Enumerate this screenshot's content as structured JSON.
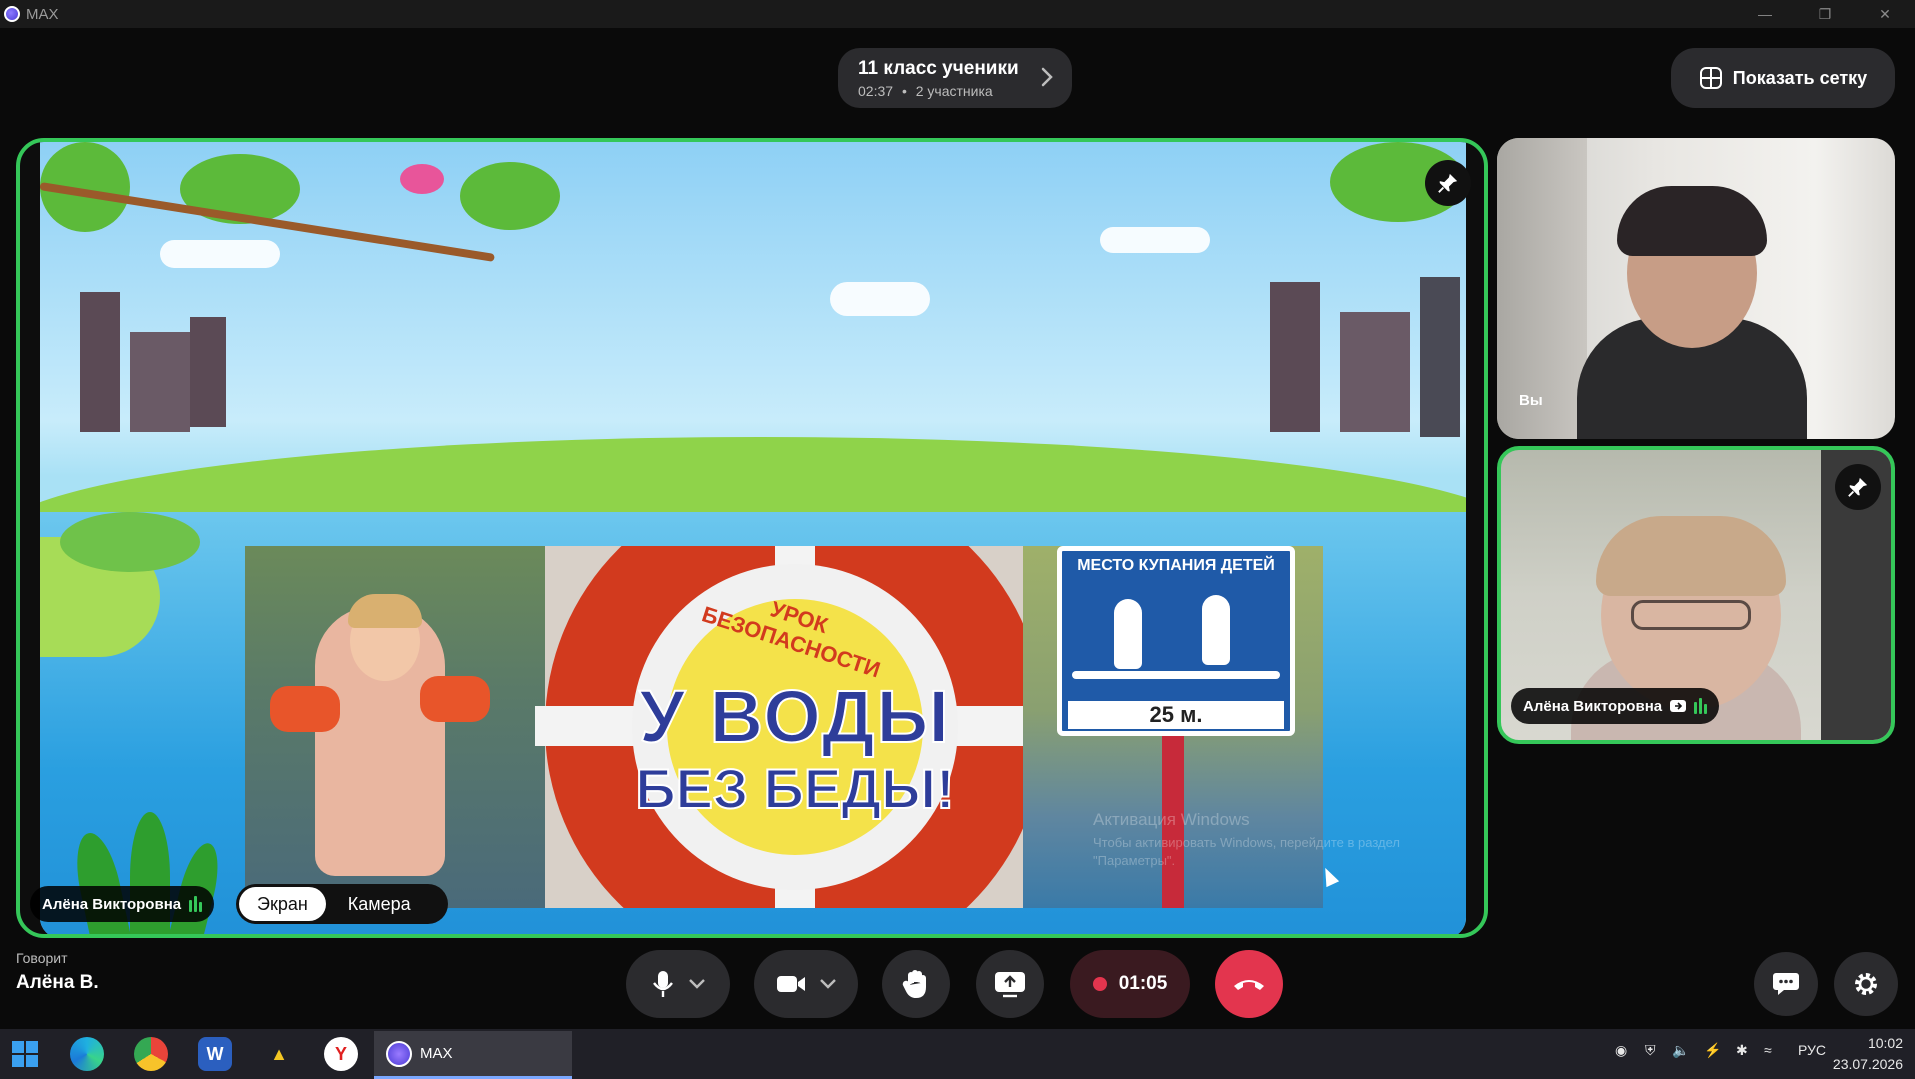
{
  "window": {
    "app_title": "MAX"
  },
  "call": {
    "name": "11 класс ученики",
    "duration": "02:37",
    "separator": "•",
    "participants": "2 участника"
  },
  "grid_button": {
    "label": "Показать сетку"
  },
  "stage": {
    "presenter_name": "Алёна Викторовна",
    "switcher": {
      "screen": "Экран",
      "camera": "Камера",
      "active": "screen"
    },
    "slide": {
      "subtitle": "УРОК БЕЗОПАСНОСТИ",
      "title_line1": "У ВОДЫ",
      "title_line2": "БЕЗ БЕДЫ!",
      "sign_title": "МЕСТО КУПАНИЯ ДЕТЕЙ",
      "sign_distance": "25 м."
    },
    "watermark": {
      "line1": "Активация Windows",
      "line2": "Чтобы активировать Windows, перейдите в раздел \"Параметры\"."
    }
  },
  "tiles": {
    "you": {
      "label": "Вы"
    },
    "alena": {
      "name": "Алёна Викторовна"
    }
  },
  "bottom": {
    "speaking_label": "Говорит",
    "speaking_name": "Алёна В.",
    "record_time": "01:05"
  },
  "taskbar": {
    "max_label": "MAX",
    "language": "РУС",
    "time": "10:02",
    "date": "23.07.2026"
  },
  "colors": {
    "accent_green": "#35c759",
    "hangup_red": "#e3354e",
    "panel": "#2b2b2e"
  }
}
